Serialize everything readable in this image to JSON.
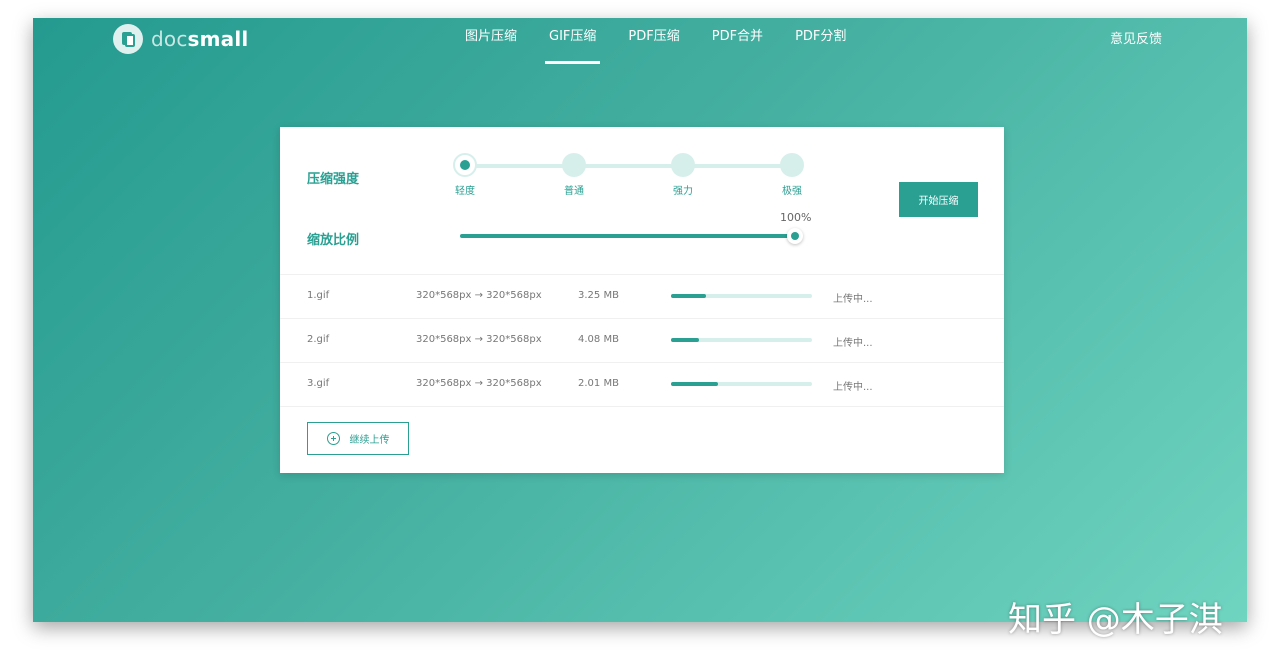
{
  "brand": {
    "prefix": "doc",
    "suffix": "small"
  },
  "nav": [
    {
      "label": "图片压缩",
      "active": false
    },
    {
      "label": "GIF压缩",
      "active": true
    },
    {
      "label": "PDF压缩",
      "active": false
    },
    {
      "label": "PDF合并",
      "active": false
    },
    {
      "label": "PDF分割",
      "active": false
    }
  ],
  "feedback": "意见反馈",
  "compression": {
    "label": "压缩强度",
    "levels": [
      "轻度",
      "普通",
      "强力",
      "极强"
    ],
    "selected_index": 0
  },
  "scale": {
    "label": "缩放比例",
    "value_text": "100%",
    "value": 100
  },
  "start_button": "开始压缩",
  "files": [
    {
      "name": "1.gif",
      "dimensions": "320*568px → 320*568px",
      "size": "3.25 MB",
      "progress": 0.25,
      "status": "上传中..."
    },
    {
      "name": "2.gif",
      "dimensions": "320*568px → 320*568px",
      "size": "4.08 MB",
      "progress": 0.2,
      "status": "上传中..."
    },
    {
      "name": "3.gif",
      "dimensions": "320*568px → 320*568px",
      "size": "2.01 MB",
      "progress": 0.33,
      "status": "上传中..."
    }
  ],
  "continue_button": "继续上传",
  "watermark": "知乎 @木子淇",
  "colors": {
    "accent": "#2aa093",
    "track": "#d6efeb"
  }
}
